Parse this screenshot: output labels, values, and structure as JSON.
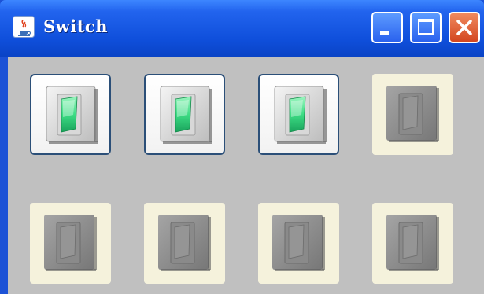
{
  "window": {
    "title": "Switch",
    "app_icon": "java-coffee-cup-icon",
    "controls": [
      "minimize-icon",
      "maximize-icon",
      "close-icon"
    ]
  },
  "switches": [
    {
      "state": "on"
    },
    {
      "state": "on"
    },
    {
      "state": "on"
    },
    {
      "state": "off"
    },
    {
      "state": "off"
    },
    {
      "state": "off"
    },
    {
      "state": "off"
    },
    {
      "state": "off"
    }
  ],
  "colors": {
    "titlebar_blue": "#0f4fdb",
    "switch_on_green": "#3ddc84",
    "switch_off_gray": "#8a8a8a",
    "background": "#c0c0c0"
  }
}
